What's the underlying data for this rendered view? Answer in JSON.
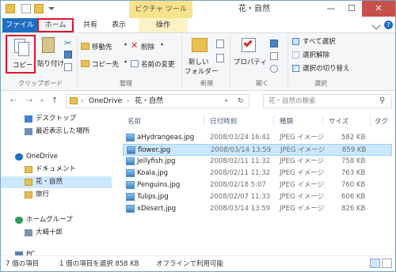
{
  "window": {
    "title": "花・自然",
    "context_tab_group": "ピクチャ ツール",
    "controls": {
      "minimize": "—",
      "maximize": "☐",
      "close": "✕"
    }
  },
  "tabs": [
    {
      "label": "ファイル"
    },
    {
      "label": "ホーム"
    },
    {
      "label": "共有"
    },
    {
      "label": "表示"
    },
    {
      "label": "操作"
    }
  ],
  "ribbon": {
    "clipboard": {
      "copy": "コピー",
      "paste": "貼り付け",
      "label": "クリップボード"
    },
    "organize": {
      "move_to": "移動先",
      "copy_to": "コピー先",
      "delete": "削除",
      "rename": "名前の変更",
      "label": "整理"
    },
    "new": {
      "new_folder_line1": "新しい",
      "new_folder_line2": "フォルダー",
      "label": "新規"
    },
    "open": {
      "properties": "プロパティ",
      "label": "開く"
    },
    "select": {
      "select_all": "すべて選択",
      "select_none": "選択解除",
      "invert": "選択の切り替え",
      "label": "選択"
    }
  },
  "address": {
    "crumbs": [
      "OneDrive",
      "花・自然"
    ],
    "search_placeholder": "花・自然の検索"
  },
  "nav": {
    "items": [
      {
        "label": "デスクトップ"
      },
      {
        "label": "最近表示した場所"
      },
      {
        "label": "OneDrive"
      },
      {
        "label": "ドキュメント"
      },
      {
        "label": "花・自然"
      },
      {
        "label": "旅行"
      },
      {
        "label": "ホームグループ"
      },
      {
        "label": "大崎十郎"
      },
      {
        "label": "PC"
      }
    ]
  },
  "columns": {
    "name": "名前",
    "date": "日付時刻",
    "type": "種類",
    "size": "サイズ",
    "tag": "タグ"
  },
  "files": [
    {
      "name": "aHydrangeas.jpg",
      "date": "2008/03/24 16:41",
      "type": "JPEG イメージ",
      "size": "582 KB"
    },
    {
      "name": "flower.jpg",
      "date": "2008/03/14 13:59",
      "type": "JPEG イメージ",
      "size": "859 KB"
    },
    {
      "name": "Jellyfish.jpg",
      "date": "2008/02/11 11:32",
      "type": "JPEG イメージ",
      "size": "758 KB"
    },
    {
      "name": "Koala.jpg",
      "date": "2008/02/11 11:32",
      "type": "JPEG イメージ",
      "size": "763 KB"
    },
    {
      "name": "Penguins.jpg",
      "date": "2008/02/18 5:07",
      "type": "JPEG イメージ",
      "size": "760 KB"
    },
    {
      "name": "Tulips.jpg",
      "date": "2008/02/07 11:33",
      "type": "JPEG イメージ",
      "size": "606 KB"
    },
    {
      "name": "xDesert.jpg",
      "date": "2008/03/14 13:59",
      "type": "JPEG イメージ",
      "size": "826 KB"
    }
  ],
  "status": {
    "count": "7 個の項目",
    "selection": "1 個の項目を選択 858 KB",
    "offline": "オフラインで利用可能"
  },
  "colors": {
    "accent": "#1e6ec2",
    "highlight": "#e0142d",
    "selection": "#cce8ff"
  }
}
